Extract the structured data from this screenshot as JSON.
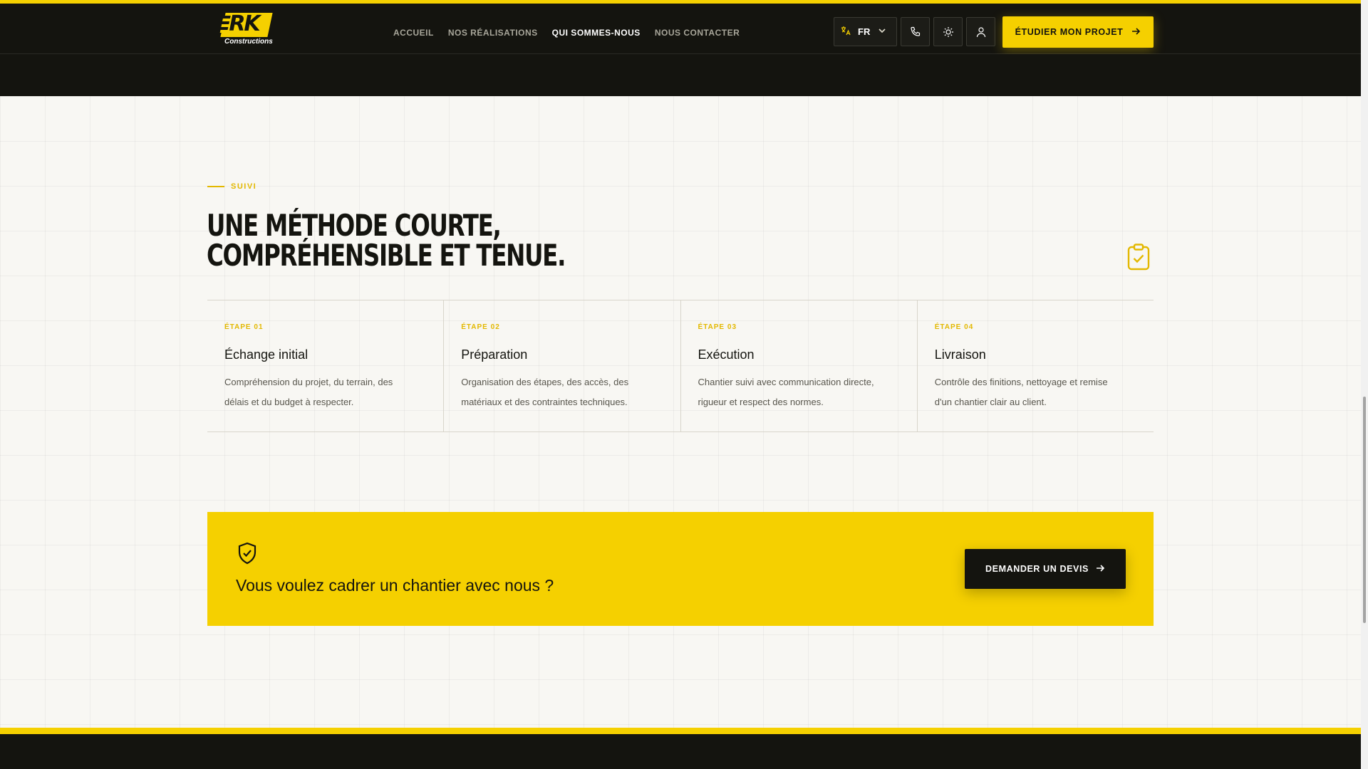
{
  "brand": {
    "logo_text": "RK",
    "logo_sub": "Constructions",
    "accent": "#f5d000",
    "dark": "#14140f"
  },
  "nav": {
    "items": [
      {
        "label": "Accueil"
      },
      {
        "label": "Nos réalisations"
      },
      {
        "label": "Qui sommes-nous"
      },
      {
        "label": "Nous contacter"
      }
    ]
  },
  "header": {
    "lang_label": "FR",
    "lang_icon": "translate-icon",
    "phone_icon": "phone-icon",
    "theme_icon": "sun-icon",
    "account_icon": "user-icon",
    "cta_label": "ÉTUDIER MON PROJET"
  },
  "method": {
    "eyebrow": "SUIVI",
    "title_line1": "UNE MÉTHODE COURTE,",
    "title_line2": "COMPRÉHENSIBLE ET TENUE.",
    "icon": "clipboard-check-icon",
    "steps": [
      {
        "label": "ÉTAPE 01",
        "title": "Échange initial",
        "desc_line1": "Compréhension du projet, du terrain, des",
        "desc_line2": "délais et du budget à respecter."
      },
      {
        "label": "ÉTAPE 02",
        "title": "Préparation",
        "desc_line1": "Organisation des étapes, des accès, des",
        "desc_line2": "matériaux et des contraintes techniques."
      },
      {
        "label": "ÉTAPE 03",
        "title": "Exécution",
        "desc_line1": "Chantier suivi avec communication directe,",
        "desc_line2": "rigueur et respect des normes."
      },
      {
        "label": "ÉTAPE 04",
        "title": "Livraison",
        "desc_line1": "Contrôle des finitions, nettoyage et remise",
        "desc_line2": "d'un chantier clair au client."
      }
    ]
  },
  "cta_band": {
    "icon": "shield-check-icon",
    "title": "Vous voulez cadrer un chantier avec nous ?",
    "button_label": "DEMANDER UN DEVIS"
  }
}
